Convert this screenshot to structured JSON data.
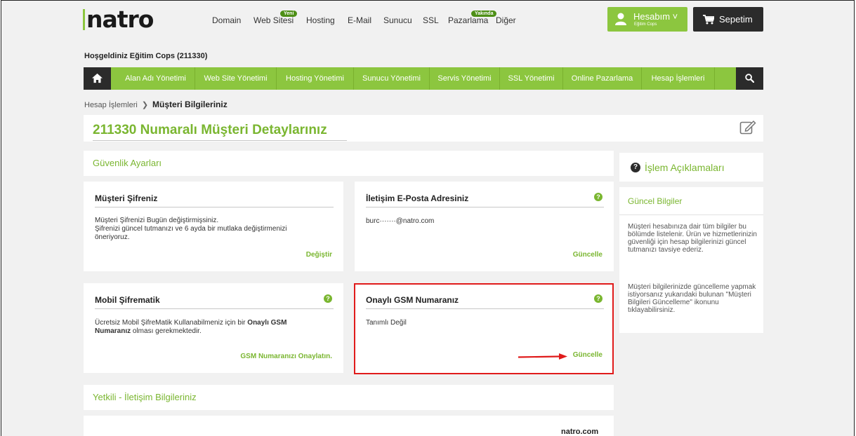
{
  "header": {
    "logo_text": "natro",
    "nav": [
      {
        "label": "Domain"
      },
      {
        "label": "Web Sitesi",
        "badge": "Yeni"
      },
      {
        "label": "Hosting"
      },
      {
        "label": "E-Mail"
      },
      {
        "label": "Sunucu"
      },
      {
        "label": "SSL"
      },
      {
        "label": "Pazarlama",
        "badge": "Yakında"
      },
      {
        "label": "Diğer"
      }
    ],
    "account_label": "Hesabım ˅",
    "account_sub": "Eğitim Cops",
    "cart_label": "Sepetim"
  },
  "welcome_text": "Hoşgeldiniz Eğitim Cops (211330)",
  "mainnav": {
    "items": [
      "Alan Adı Yönetimi",
      "Web Site Yönetimi",
      "Hosting Yönetimi",
      "Sunucu Yönetimi",
      "Servis Yönetimi",
      "SSL Yönetimi",
      "Online Pazarlama",
      "Hesap İşlemleri"
    ]
  },
  "breadcrumb": {
    "parent": "Hesap İşlemleri",
    "separator": "❯",
    "current": "Müşteri Bilgileriniz"
  },
  "page_title": "211330 Numaralı Müşteri Detaylarınız",
  "security": {
    "heading": "Güvenlik Ayarları",
    "password_card": {
      "title": "Müşteri Şifreniz",
      "line1": "Müşteri Şifrenizi Bugün değiştirmişsiniz.",
      "line2": "Şifrenizi güncel tutmanızı ve 6 ayda bir mutlaka değiştirmenizi",
      "line3": "öneriyoruz.",
      "action": "Değiştir"
    },
    "email_card": {
      "title": "İletişim E-Posta Adresiniz",
      "value": "burc·······@natro.com",
      "action": "Güncelle"
    },
    "mobile_card": {
      "title": "Mobil Şifrematik",
      "text_pre": "Ücretsiz Mobil ŞifreMatik Kullanabilmeniz için bir ",
      "text_bold1": "Onaylı GSM",
      "text_bold2": "Numaranız",
      "text_post": " olması gerekmektedir.",
      "action": "GSM Numaranızı Onaylatın."
    },
    "gsm_card": {
      "title": "Onaylı GSM Numaranız",
      "value": "Tanımlı Değil",
      "action": "Güncelle"
    }
  },
  "contact": {
    "heading": "Yetkili - İletişim Bilgileriniz"
  },
  "sidebar": {
    "heading": "İşlem Açıklamaları",
    "box_title": "Güncel Bilgiler",
    "para1": "Müşteri hesabınıza dair tüm bilgiler bu bölümde listelenir. Ürün ve hizmetlerinizin güvenliği için hesap bilgilerinizi güncel tutmanızı tavsiye ederiz.",
    "para2": "Müşteri bilgilerinizde güncelleme yapmak istiyorsanız yukarıdaki bulunan \"Müşteri Bilgileri Güncelleme\" ikonunu tıklayabilirsiniz."
  },
  "footer_brand": "natro.com",
  "colors": {
    "brand_green": "#8cc63f",
    "dark": "#2b2b2b",
    "highlight_red": "#e01b1b"
  }
}
